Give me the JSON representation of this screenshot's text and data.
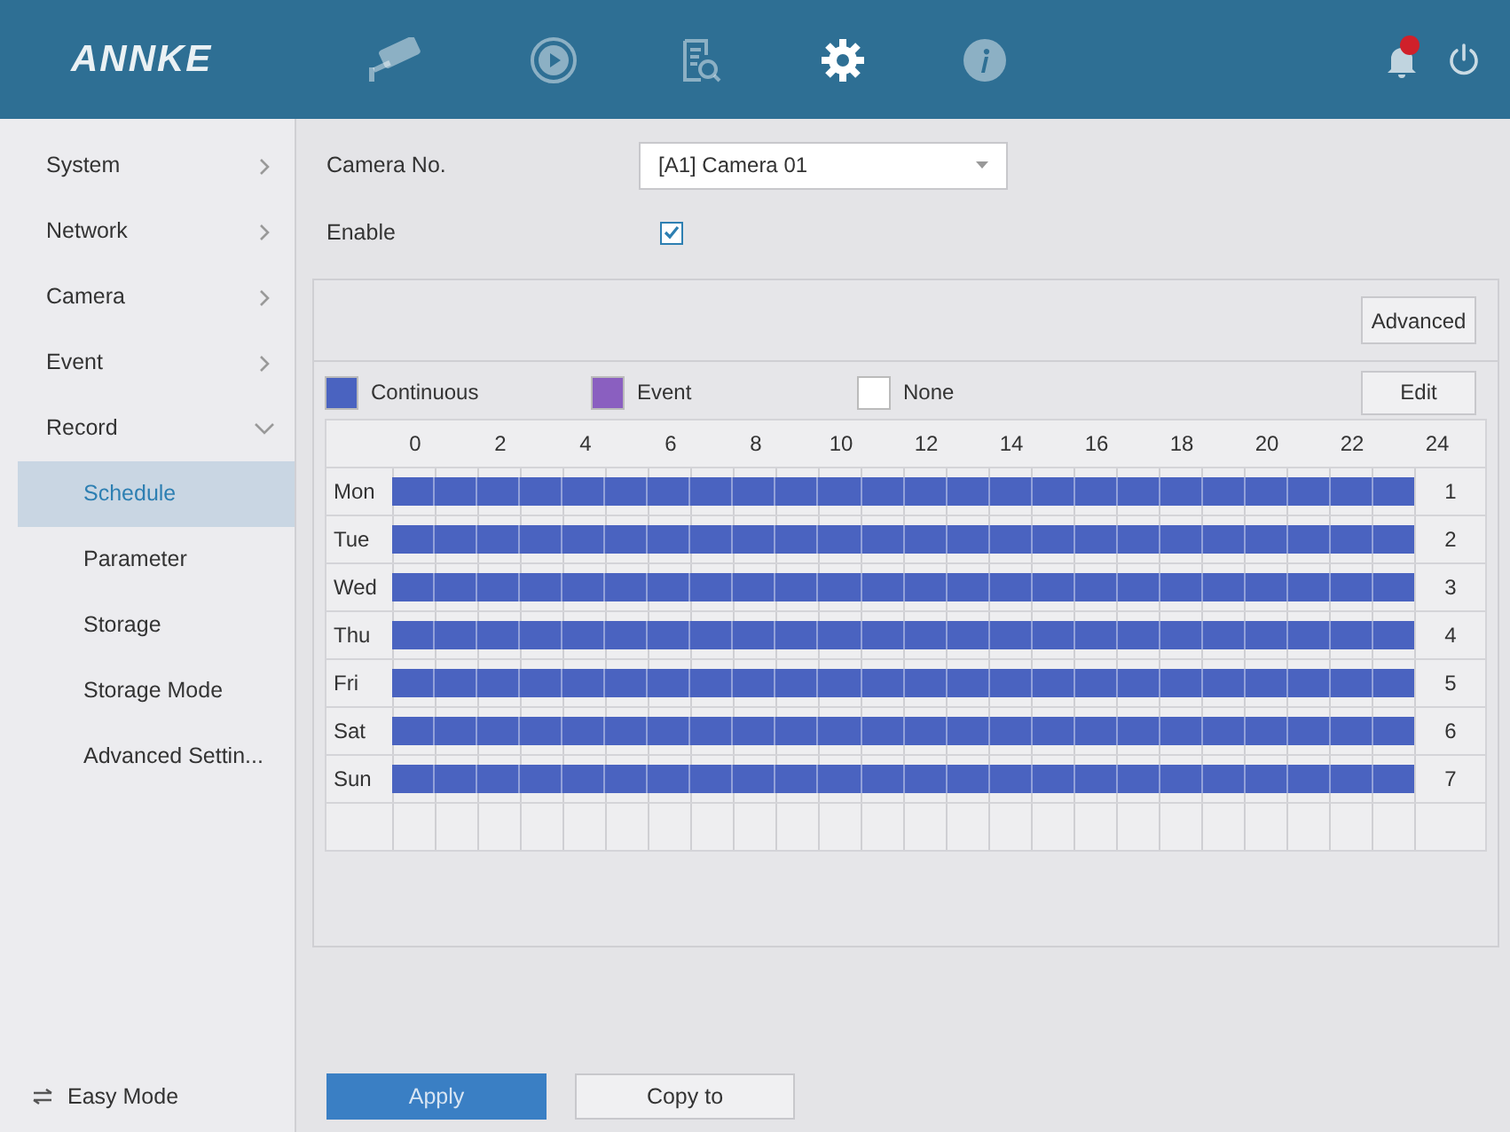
{
  "header": {
    "logo": "ANNKE",
    "nav": [
      {
        "kind": "camera",
        "selected": false
      },
      {
        "kind": "playback",
        "selected": false
      },
      {
        "kind": "search",
        "selected": false
      },
      {
        "kind": "settings",
        "selected": true
      },
      {
        "kind": "info",
        "selected": false
      }
    ],
    "alarm_badge": true
  },
  "sidebar": {
    "items": [
      {
        "label": "System",
        "expanded": false,
        "selected": false
      },
      {
        "label": "Network",
        "expanded": false,
        "selected": false
      },
      {
        "label": "Camera",
        "expanded": false,
        "selected": false
      },
      {
        "label": "Event",
        "expanded": false,
        "selected": false
      },
      {
        "label": "Record",
        "expanded": true,
        "selected": false,
        "children": [
          {
            "label": "Schedule",
            "selected": true
          },
          {
            "label": "Parameter",
            "selected": false
          },
          {
            "label": "Storage",
            "selected": false
          },
          {
            "label": "Storage Mode",
            "selected": false
          },
          {
            "label": "Advanced Settin...",
            "selected": false
          }
        ]
      }
    ],
    "footer": "Easy Mode"
  },
  "form": {
    "camera_label": "Camera No.",
    "camera_value": "[A1] Camera 01",
    "enable_label": "Enable",
    "enable_checked": true
  },
  "schedule": {
    "advanced_button": "Advanced",
    "edit_button": "Edit",
    "legend": [
      {
        "kind": "continuous",
        "label": "Continuous",
        "color": "#4a63c0"
      },
      {
        "kind": "event",
        "label": "Event",
        "color": "#8a5fc0"
      },
      {
        "kind": "none",
        "label": "None",
        "color": "#ffffff"
      }
    ],
    "hours": [
      "0",
      "2",
      "4",
      "6",
      "8",
      "10",
      "12",
      "14",
      "16",
      "18",
      "20",
      "22",
      "24"
    ],
    "days": [
      {
        "label": "Mon",
        "number": "1",
        "kind": "continuous"
      },
      {
        "label": "Tue",
        "number": "2",
        "kind": "continuous"
      },
      {
        "label": "Wed",
        "number": "3",
        "kind": "continuous"
      },
      {
        "label": "Thu",
        "number": "4",
        "kind": "continuous"
      },
      {
        "label": "Fri",
        "number": "5",
        "kind": "continuous"
      },
      {
        "label": "Sat",
        "number": "6",
        "kind": "continuous"
      },
      {
        "label": "Sun",
        "number": "7",
        "kind": "continuous"
      }
    ]
  },
  "buttons": [
    {
      "label": "Apply",
      "primary": true
    },
    {
      "label": "Copy to",
      "primary": false
    }
  ]
}
